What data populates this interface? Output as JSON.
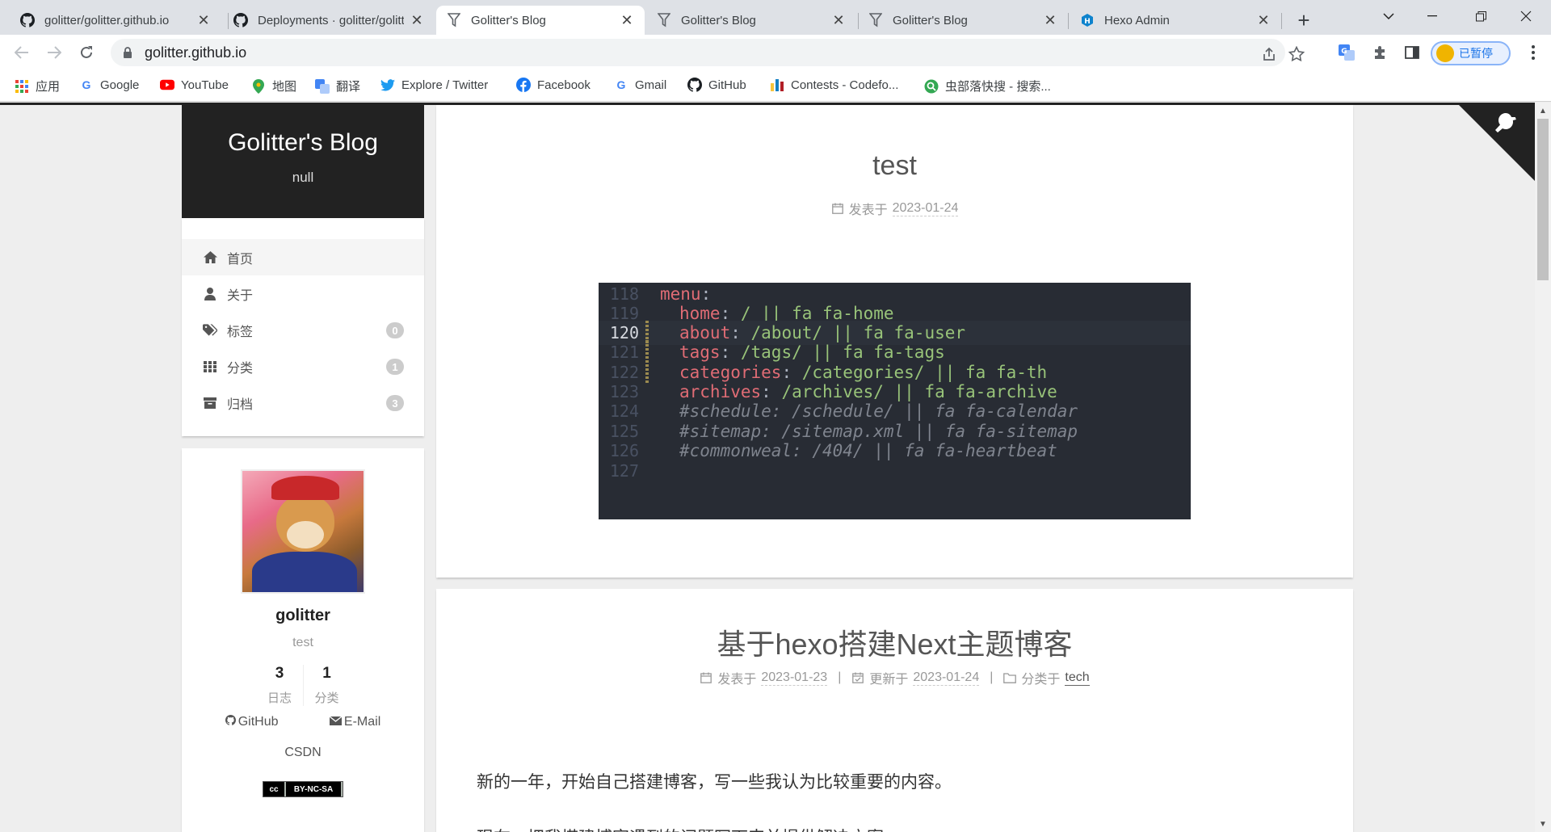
{
  "browser": {
    "tabs": [
      {
        "title": "golitter/golitter.github.io",
        "icon": "github-icon",
        "active": false
      },
      {
        "title": "Deployments · golitter/golitter",
        "icon": "github-icon",
        "active": false
      },
      {
        "title": "Golitter's Blog",
        "icon": "funnel-icon",
        "active": true
      },
      {
        "title": "Golitter's Blog",
        "icon": "funnel-icon",
        "active": false
      },
      {
        "title": "Golitter's Blog",
        "icon": "funnel-icon",
        "active": false
      },
      {
        "title": "Hexo Admin",
        "icon": "hexo-icon",
        "active": false
      }
    ],
    "url": "golitter.github.io",
    "profile_label": "已暂停",
    "bookmarks": [
      {
        "label": "应用",
        "icon": "apps-grid-icon"
      },
      {
        "label": "Google",
        "icon": "google-icon"
      },
      {
        "label": "YouTube",
        "icon": "youtube-icon"
      },
      {
        "label": "地图",
        "icon": "maps-icon"
      },
      {
        "label": "翻译",
        "icon": "translate-icon"
      },
      {
        "label": "Explore / Twitter",
        "icon": "twitter-icon"
      },
      {
        "label": "Facebook",
        "icon": "facebook-icon"
      },
      {
        "label": "Gmail",
        "icon": "google-icon"
      },
      {
        "label": "GitHub",
        "icon": "github-icon"
      },
      {
        "label": "Contests - Codefo...",
        "icon": "codeforces-icon"
      },
      {
        "label": "虫部落快搜 - 搜索...",
        "icon": "search-icon"
      }
    ]
  },
  "site": {
    "title": "Golitter's Blog",
    "subtitle": "null",
    "menu": [
      {
        "label": "首页",
        "icon": "home-icon",
        "badge": null,
        "active": true
      },
      {
        "label": "关于",
        "icon": "user-icon",
        "badge": null,
        "active": false
      },
      {
        "label": "标签",
        "icon": "tags-icon",
        "badge": "0",
        "active": false
      },
      {
        "label": "分类",
        "icon": "th-icon",
        "badge": "1",
        "active": false
      },
      {
        "label": "归档",
        "icon": "archive-icon",
        "badge": "3",
        "active": false
      }
    ],
    "author": {
      "name": "golitter",
      "description": "test",
      "stats": [
        {
          "count": "3",
          "label": "日志"
        },
        {
          "count": "1",
          "label": "分类"
        }
      ],
      "links": {
        "github": "GitHub",
        "email": "E-Mail",
        "csdn": "CSDN"
      },
      "license": "BY-NC-SA"
    }
  },
  "posts": [
    {
      "title": "test",
      "published_label": "发表于",
      "published_date": "2023-01-24"
    },
    {
      "title": "基于hexo搭建Next主题博客",
      "published_label": "发表于",
      "published_date": "2023-01-23",
      "updated_label": "更新于",
      "updated_date": "2023-01-24",
      "category_label": "分类于",
      "category": "tech",
      "excerpt": "新的一年，开始自己搭建博客，写一些我认为比较重要的内容。",
      "excerpt2": "现在，把我搭建博客遇到的问题写下来并提供解决方案。"
    }
  ],
  "code_image": {
    "lines": [
      {
        "num": "118",
        "key": "menu",
        "value": "",
        "comment": false
      },
      {
        "num": "119",
        "key": "home",
        "value": "/ || fa fa-home",
        "comment": false
      },
      {
        "num": "120",
        "key": "about",
        "value": "/about/ || fa fa-user",
        "comment": false,
        "current": true
      },
      {
        "num": "121",
        "key": "tags",
        "value": "/tags/ || fa fa-tags",
        "comment": false
      },
      {
        "num": "122",
        "key": "categories",
        "value": "/categories/ || fa fa-th",
        "comment": false
      },
      {
        "num": "123",
        "key": "archives",
        "value": "/archives/ || fa fa-archive",
        "comment": false
      },
      {
        "num": "124",
        "text": "#schedule: /schedule/ || fa fa-calendar",
        "comment": true
      },
      {
        "num": "125",
        "text": "#sitemap: /sitemap.xml || fa fa-sitemap",
        "comment": true
      },
      {
        "num": "126",
        "text": "#commonweal: /404/ || fa fa-heartbeat",
        "comment": true
      },
      {
        "num": "127",
        "text": "",
        "comment": false
      }
    ]
  },
  "colors": {
    "header_bg": "#222222",
    "code_bg": "#282c34",
    "code_key": "#e06c75",
    "code_value": "#98c379",
    "code_comment": "#7f848e"
  }
}
